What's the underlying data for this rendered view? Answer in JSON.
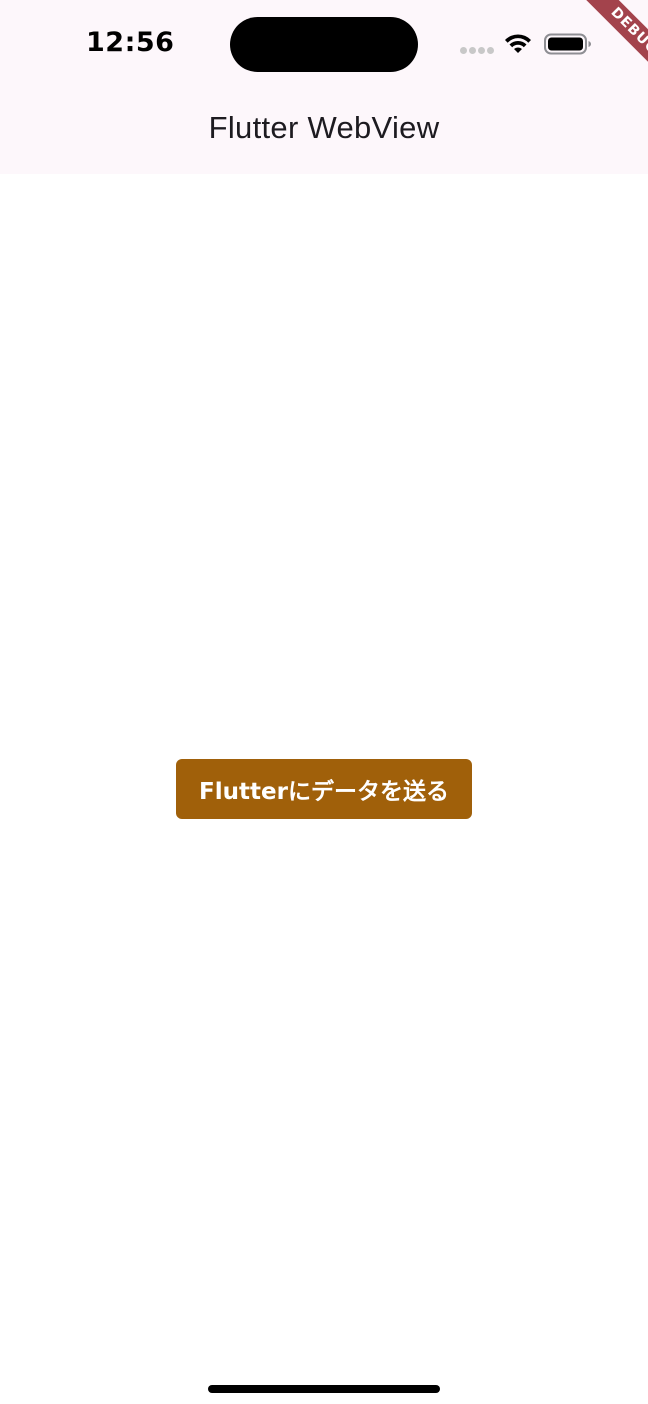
{
  "status_bar": {
    "time": "12:56"
  },
  "debug_banner": {
    "label": "DEBUG",
    "color": "#a3434c"
  },
  "app_bar": {
    "title": "Flutter WebView",
    "background": "#fdf7fb"
  },
  "webview": {
    "send_button_label": "Flutterにデータを送る",
    "button_color": "#a0600a"
  },
  "icons": {
    "wifi": "wifi-icon",
    "battery": "battery-icon",
    "signal": "cellular-signal-icon"
  }
}
